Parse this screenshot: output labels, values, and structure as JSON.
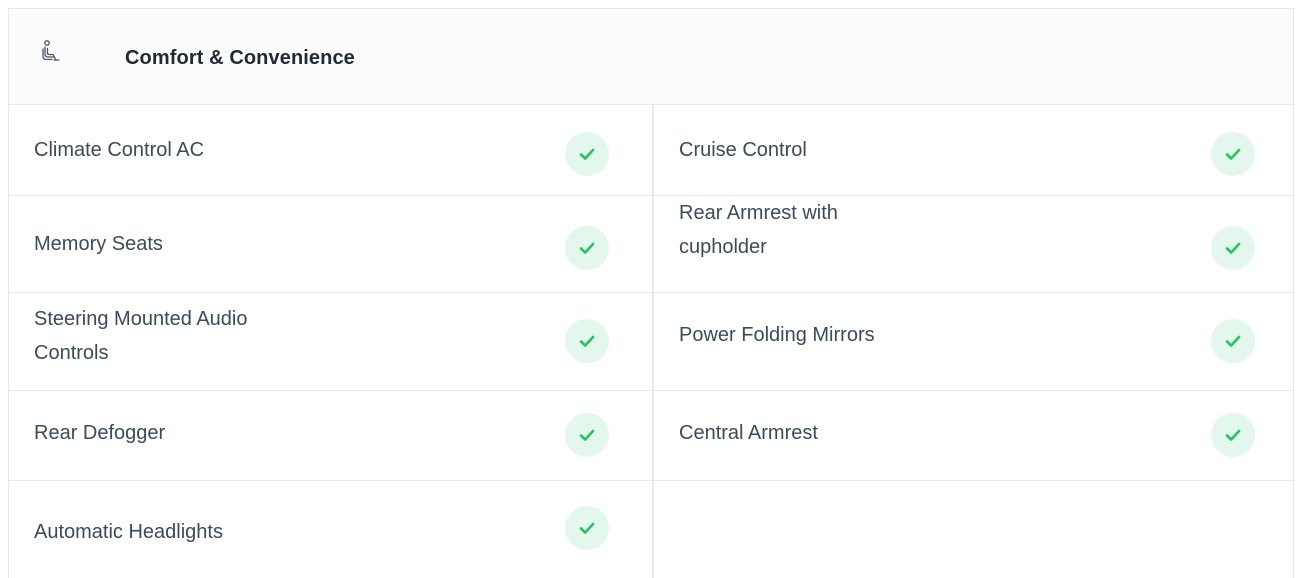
{
  "section": {
    "title": "Comfort & Convenience",
    "icon": "seat-icon"
  },
  "accent_color": "#22c55e",
  "check_bg_color": "#e4f7ec",
  "features": {
    "r0": {
      "left": {
        "label": "Climate Control AC",
        "available": true
      },
      "right": {
        "label": "Cruise Control",
        "available": true
      }
    },
    "r1": {
      "left": {
        "label": "Memory Seats",
        "available": true
      },
      "right": {
        "label": "Rear Armrest with cupholder",
        "available": true
      }
    },
    "r2": {
      "left": {
        "label": "Steering Mounted Audio Controls",
        "available": true
      },
      "right": {
        "label": "Power Folding Mirrors",
        "available": true
      }
    },
    "r3": {
      "left": {
        "label": "Rear Defogger",
        "available": true
      },
      "right": {
        "label": "Central Armrest",
        "available": true
      }
    },
    "r4": {
      "left": {
        "label": "Automatic Headlights",
        "available": true
      }
    }
  }
}
